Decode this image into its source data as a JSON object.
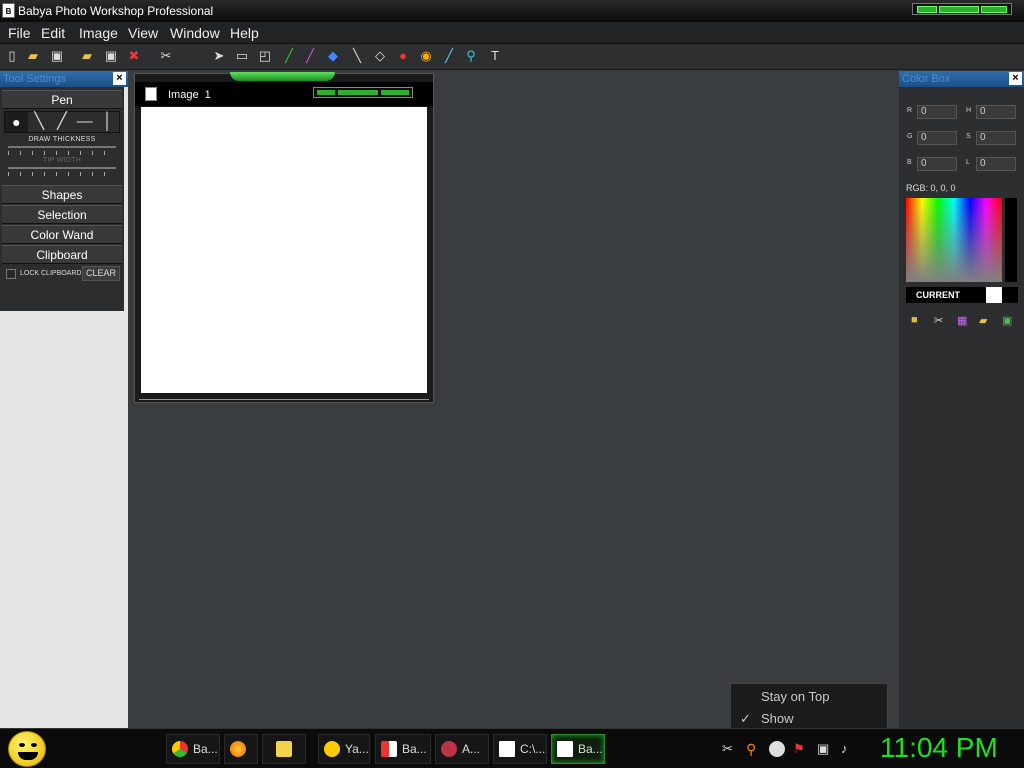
{
  "window": {
    "title": "Babya Photo Workshop Professional"
  },
  "menu": [
    "File",
    "Edit",
    "Image",
    "View",
    "Window",
    "Help"
  ],
  "toolbar": {
    "icons": [
      "new-icon",
      "open-icon",
      "save-icon",
      "open-folder-icon",
      "save-as-icon",
      "close-red-icon",
      "cut-icon",
      "pointer-icon",
      "rect-select-icon",
      "lasso-icon",
      "pen-icon",
      "brush-icon",
      "fill-icon",
      "line-icon",
      "eraser-icon",
      "color-icon",
      "eye-icon",
      "picker-icon",
      "zoom-icon",
      "text-icon"
    ]
  },
  "tool_settings": {
    "title": "Tool Settings",
    "pen_label": "Pen",
    "draw_thickness": "DRAW THICKNESS",
    "tip_width": "TIP WIDTH",
    "sections": [
      "Shapes",
      "Selection",
      "Color Wand",
      "Clipboard"
    ],
    "lock_clipboard": "LOCK CLIPBOARD",
    "clear": "CLEAR"
  },
  "document": {
    "title": "Image  1"
  },
  "color_box": {
    "title": "Color Box",
    "R": "0",
    "H": "0",
    "G": "0",
    "S": "0",
    "B": "0",
    "L": "0",
    "rgb_text": "RGB: 0, 0, 0",
    "current": "CURRENT"
  },
  "popup": {
    "stay_on_top": "Stay on Top",
    "show": "Show",
    "show_check": "✓"
  },
  "taskbar": {
    "tasks": [
      {
        "label": "Ba...",
        "icon": "chrome-icon"
      },
      {
        "label": "",
        "icon": "firefox-icon"
      },
      {
        "label": "",
        "icon": "folder-icon"
      },
      {
        "label": "Ya...",
        "icon": "yahoo-icon"
      },
      {
        "label": "Ba...",
        "icon": "babya-icon"
      },
      {
        "label": "A...",
        "icon": "app-icon"
      },
      {
        "label": "C:\\...",
        "icon": "7zip-icon"
      },
      {
        "label": "Ba...",
        "icon": "babya-active-icon"
      }
    ],
    "clock": "11:04 PM"
  }
}
